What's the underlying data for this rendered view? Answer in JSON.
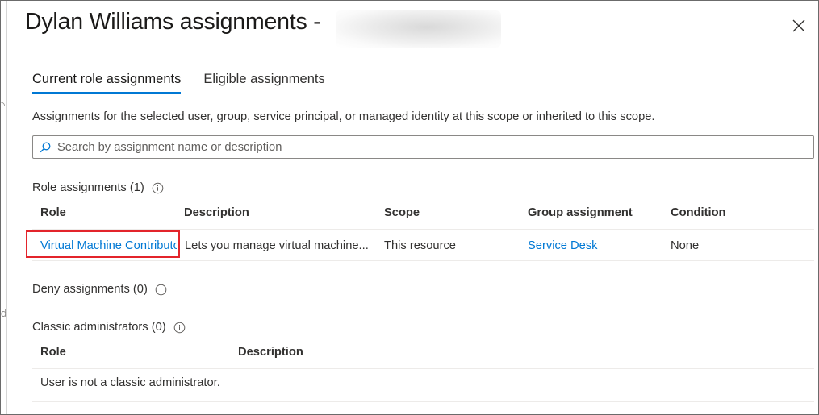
{
  "panel": {
    "title": "Dylan Williams assignments -",
    "close_label": "×"
  },
  "tabs": [
    {
      "label": "Current role assignments",
      "active": true
    },
    {
      "label": "Eligible assignments",
      "active": false
    }
  ],
  "subtitle": "Assignments for the selected user, group, service principal, or managed identity at this scope or inherited to this scope.",
  "search": {
    "placeholder": "Search by assignment name or description",
    "value": ""
  },
  "role_assignments": {
    "label": "Role assignments (1)",
    "columns": [
      "Role",
      "Description",
      "Scope",
      "Group assignment",
      "Condition"
    ],
    "rows": [
      {
        "role": "Virtual Machine Contributor",
        "description": "Lets you manage virtual machine...",
        "scope": "This resource",
        "group_assignment": "Service Desk",
        "condition": "None"
      }
    ]
  },
  "deny_assignments": {
    "label": "Deny assignments (0)"
  },
  "classic_admins": {
    "label": "Classic administrators (0)",
    "columns": [
      "Role",
      "Description"
    ],
    "empty_message": "User is not a classic administrator."
  },
  "colors": {
    "accent": "#0078d4",
    "link": "#0078d4",
    "highlight": "#e3242b"
  },
  "icons": [
    "close-icon",
    "search-icon",
    "info-icon"
  ]
}
